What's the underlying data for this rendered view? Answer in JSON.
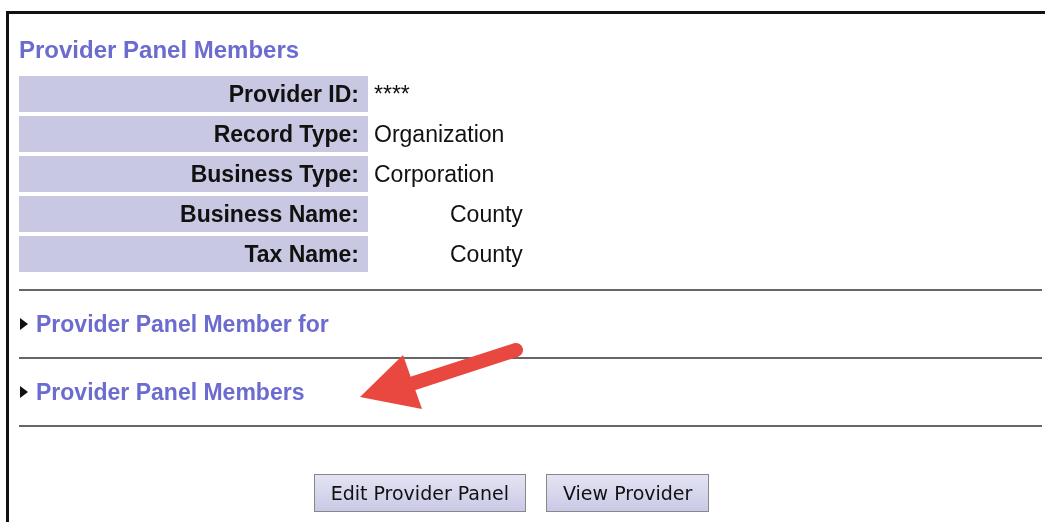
{
  "title": "Provider Panel Members",
  "fields": [
    {
      "label": "Provider ID:",
      "value": "****",
      "masked": false
    },
    {
      "label": "Record Type:",
      "value": "Organization",
      "masked": false
    },
    {
      "label": "Business Type:",
      "value": "Corporation",
      "masked": false
    },
    {
      "label": "Business Name:",
      "value": "County",
      "masked": true
    },
    {
      "label": "Tax Name:",
      "value": "County",
      "masked": true
    }
  ],
  "sections": [
    {
      "label": "Provider Panel Member for",
      "expanded": false
    },
    {
      "label": "Provider Panel Members",
      "expanded": false
    }
  ],
  "buttons": [
    "Edit Provider Panel",
    "View Provider"
  ]
}
